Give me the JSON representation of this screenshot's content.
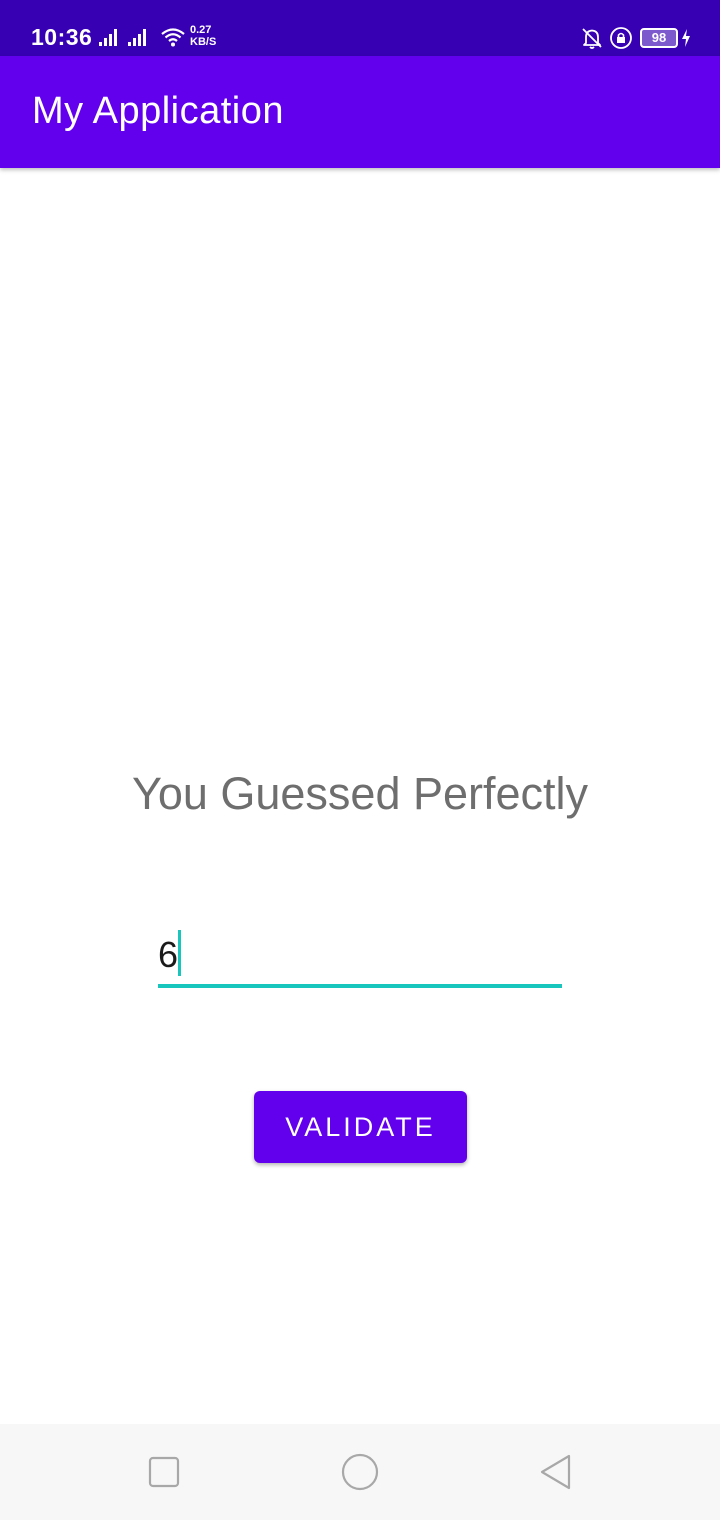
{
  "status_bar": {
    "time": "10:36",
    "net_speed_value": "0.27",
    "net_speed_unit": "KB/S",
    "battery_level": "98",
    "icons": [
      "signal-icon",
      "signal-icon",
      "wifi-icon",
      "bell-off-icon",
      "lock-rotation-icon",
      "battery-icon",
      "charging-icon"
    ]
  },
  "app_bar": {
    "title": "My Application"
  },
  "main": {
    "message": "You Guessed Perfectly",
    "guess_input": {
      "value": "6"
    },
    "validate_label": "VALIDATE"
  },
  "nav_bar": {
    "icons": [
      "recent-apps-icon",
      "home-icon",
      "back-icon"
    ]
  },
  "colors": {
    "status_bar": "#3700b3",
    "primary": "#6200ee",
    "accent": "#19c6bd",
    "message_text": "#6e6e6e",
    "nav_background": "#f7f7f7"
  }
}
